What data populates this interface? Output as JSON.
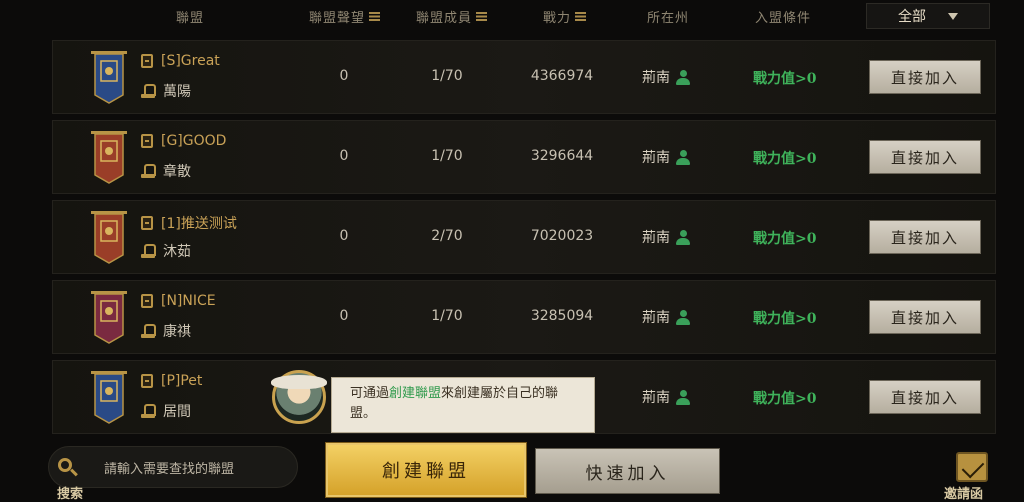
{
  "header": {
    "alliance": "聯盟",
    "reputation": "聯盟聲望",
    "members": "聯盟成員",
    "power": "戰力",
    "state": "所在州",
    "condition": "入盟條件",
    "filter_value": "全部"
  },
  "rows": [
    {
      "name": "[S]Great",
      "leader": "萬陽",
      "reputation": "0",
      "members": "1/70",
      "power": "4366974",
      "state": "荊南",
      "condition": "戰力值>0",
      "button": "直接加入",
      "banner_color": "#2a4a86"
    },
    {
      "name": "[G]GOOD",
      "leader": "章散",
      "reputation": "0",
      "members": "1/70",
      "power": "3296644",
      "state": "荊南",
      "condition": "戰力值>0",
      "button": "直接加入",
      "banner_color": "#9a3e28"
    },
    {
      "name": "[1]推送测试",
      "leader": "沐茹",
      "reputation": "0",
      "members": "2/70",
      "power": "7020023",
      "state": "荊南",
      "condition": "戰力值>0",
      "button": "直接加入",
      "banner_color": "#9a3e28"
    },
    {
      "name": "[N]NICE",
      "leader": "康祺",
      "reputation": "0",
      "members": "1/70",
      "power": "3285094",
      "state": "荊南",
      "condition": "戰力值>0",
      "button": "直接加入",
      "banner_color": "#7a2a40"
    },
    {
      "name": "[P]Pet",
      "leader": "居間",
      "reputation": "",
      "members": "",
      "power": "",
      "state": "荊南",
      "condition": "戰力值>0",
      "button": "直接加入",
      "banner_color": "#2a4a86"
    }
  ],
  "hint": {
    "prefix": "可通過",
    "highlight": "創建聯盟",
    "suffix": "來創建屬於自己的聯盟。"
  },
  "search": {
    "label": "搜索",
    "placeholder": "請輸入需要查找的聯盟"
  },
  "buttons": {
    "create": "創建聯盟",
    "quick_join": "快速加入"
  },
  "invite": {
    "label": "邀請函"
  },
  "colors": {
    "gold": "#c9a257",
    "green": "#3fb35b",
    "create_button": "#e9b93e"
  }
}
